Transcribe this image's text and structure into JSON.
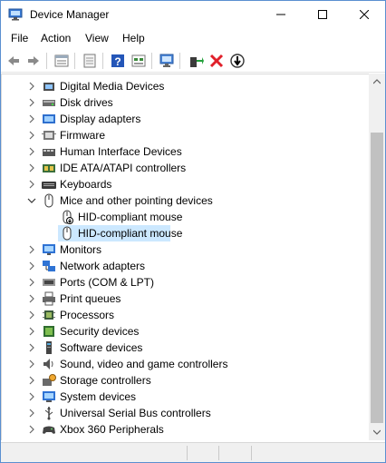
{
  "window": {
    "title": "Device Manager"
  },
  "menu": [
    "File",
    "Action",
    "View",
    "Help"
  ],
  "toolbar": {
    "buttons": [
      "back-arrow-icon",
      "forward-arrow-icon",
      "properties-icon",
      "update-driver-icon",
      "help-icon",
      "view-icon",
      "scan-hardware-icon",
      "enable-device-icon",
      "uninstall-icon",
      "disable-device-icon"
    ]
  },
  "tree": {
    "items": [
      {
        "label": "Digital Media Devices",
        "icon": "media-device-icon",
        "expanded": false
      },
      {
        "label": "Disk drives",
        "icon": "disk-drive-icon",
        "expanded": false
      },
      {
        "label": "Display adapters",
        "icon": "display-adapter-icon",
        "expanded": false
      },
      {
        "label": "Firmware",
        "icon": "firmware-icon",
        "expanded": false
      },
      {
        "label": "Human Interface Devices",
        "icon": "hid-icon",
        "expanded": false
      },
      {
        "label": "IDE ATA/ATAPI controllers",
        "icon": "ide-controller-icon",
        "expanded": false
      },
      {
        "label": "Keyboards",
        "icon": "keyboard-icon",
        "expanded": false
      },
      {
        "label": "Mice and other pointing devices",
        "icon": "mouse-icon",
        "expanded": true
      },
      {
        "label": "HID-compliant mouse",
        "icon": "mouse-disabled-icon",
        "child": true
      },
      {
        "label": "HID-compliant mouse",
        "icon": "mouse-icon",
        "child": true,
        "selected": true
      },
      {
        "label": "Monitors",
        "icon": "monitor-icon",
        "expanded": false
      },
      {
        "label": "Network adapters",
        "icon": "network-adapter-icon",
        "expanded": false
      },
      {
        "label": "Ports (COM & LPT)",
        "icon": "port-icon",
        "expanded": false
      },
      {
        "label": "Print queues",
        "icon": "printer-icon",
        "expanded": false
      },
      {
        "label": "Processors",
        "icon": "processor-icon",
        "expanded": false
      },
      {
        "label": "Security devices",
        "icon": "security-device-icon",
        "expanded": false
      },
      {
        "label": "Software devices",
        "icon": "software-device-icon",
        "expanded": false
      },
      {
        "label": "Sound, video and game controllers",
        "icon": "speaker-icon",
        "expanded": false
      },
      {
        "label": "Storage controllers",
        "icon": "storage-controller-icon",
        "expanded": false
      },
      {
        "label": "System devices",
        "icon": "system-device-icon",
        "expanded": false
      },
      {
        "label": "Universal Serial Bus controllers",
        "icon": "usb-icon",
        "expanded": false
      },
      {
        "label": "Xbox 360 Peripherals",
        "icon": "gamepad-icon",
        "expanded": false
      }
    ]
  },
  "colors": {
    "selection": "#cce8ff",
    "accent": "#1f5fbf"
  }
}
